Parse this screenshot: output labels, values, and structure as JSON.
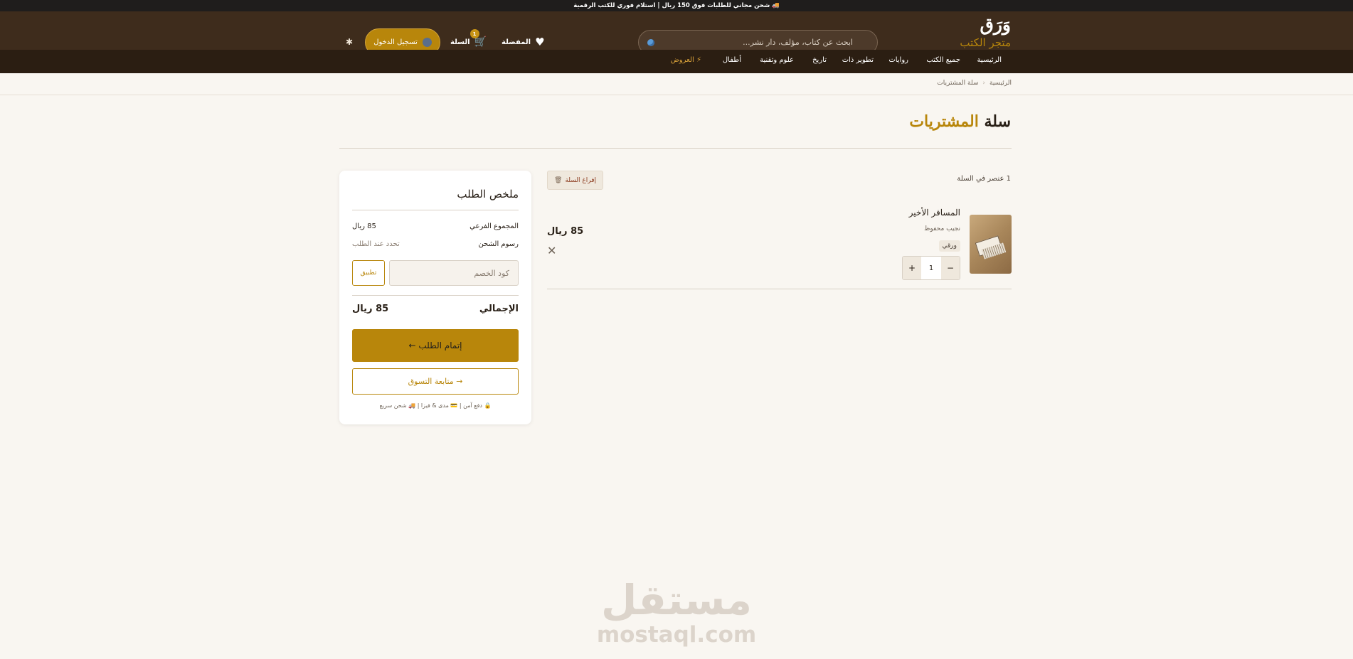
{
  "topbar": {
    "text": "🚚 شحن مجاني للطلبات فوق 150 ريال | استلام فوري للكتب الرقمية"
  },
  "header": {
    "logo_main": "وَرَق",
    "logo_sub": "متجر الكتب",
    "search_placeholder": "ابحث عن كتاب، مؤلف، دار نشر...",
    "favorites_label": "المفضلة",
    "cart_label": "السلة",
    "cart_count": "1",
    "login_label": "تسجيل الدخول"
  },
  "nav": {
    "home": "الرئيسية",
    "all_books": "جميع الكتب",
    "novels": "روايات",
    "self_dev": "تطوير ذات",
    "history": "تاريخ",
    "science": "علوم وتقنية",
    "kids": "أطفال",
    "offers": "⚡ العروض"
  },
  "breadcrumb": {
    "home": "الرئيسية",
    "current": "سلة المشتريات"
  },
  "page": {
    "title_part1": "سلة",
    "title_part2": " المشتريات",
    "items_count": "1 عنصر في السلة",
    "clear_label": "إفراغ السلة"
  },
  "cart_item": {
    "title": "المسافر الأخير",
    "author": "نجيب محفوظ",
    "type": "ورقي",
    "quantity": "1",
    "price": "85 ريال"
  },
  "summary": {
    "title": "ملخص الطلب",
    "subtotal_label": "المجموع الفرعي",
    "subtotal_value": "85 ريال",
    "shipping_label": "رسوم الشحن",
    "shipping_value": "تحدد عند الطلب",
    "coupon_placeholder": "كود الخصم",
    "apply_label": "تطبيق",
    "total_label": "الإجمالي",
    "total_value": "85 ريال",
    "checkout_label": "إتمام الطلب ←",
    "continue_label": "→ متابعة التسوق",
    "note": "🔒 دفع آمن | 💳 مدى & فيزا | 🚚 شحن سريع"
  },
  "watermark": {
    "arabic": "مستقل",
    "latin": "mostaql.com"
  }
}
